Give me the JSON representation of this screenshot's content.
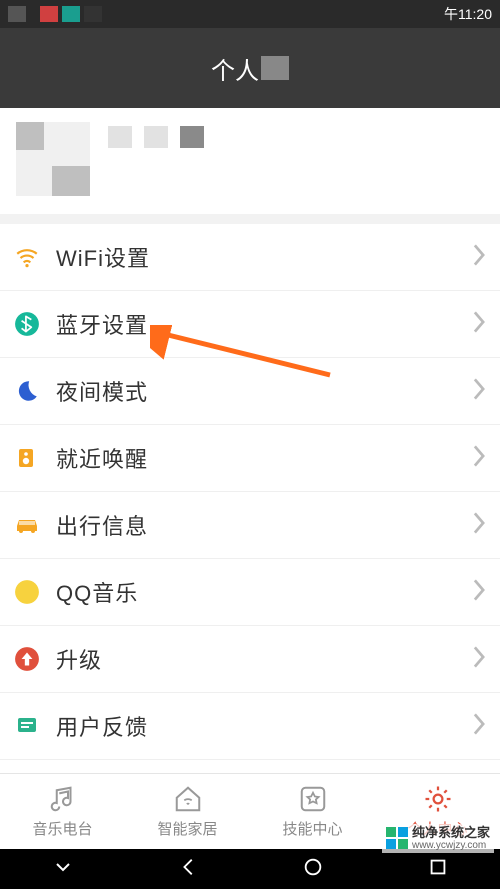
{
  "status": {
    "time": "午11:20"
  },
  "header": {
    "title_prefix": "个人"
  },
  "menu": {
    "wifi": "WiFi设置",
    "bluetooth": "蓝牙设置",
    "night": "夜间模式",
    "wake": "就近唤醒",
    "travel": "出行信息",
    "qqmusic": "QQ音乐",
    "upgrade": "升级",
    "feedback": "用户反馈"
  },
  "nav": {
    "radio": "音乐电台",
    "smarthome": "智能家居",
    "skills": "技能中心",
    "profile": "个人中心"
  },
  "watermark": {
    "line1": "纯净系统之家",
    "line2": "www.ycwjzy.com"
  },
  "colors": {
    "accent": "#e0503c",
    "bluetooth": "#16b89a",
    "wake": "#f5a623",
    "travel": "#f5a623",
    "qq": "#2bb24c",
    "upgrade": "#e0503c",
    "night": "#2d5fd1",
    "feedback": "#2bb28c"
  }
}
